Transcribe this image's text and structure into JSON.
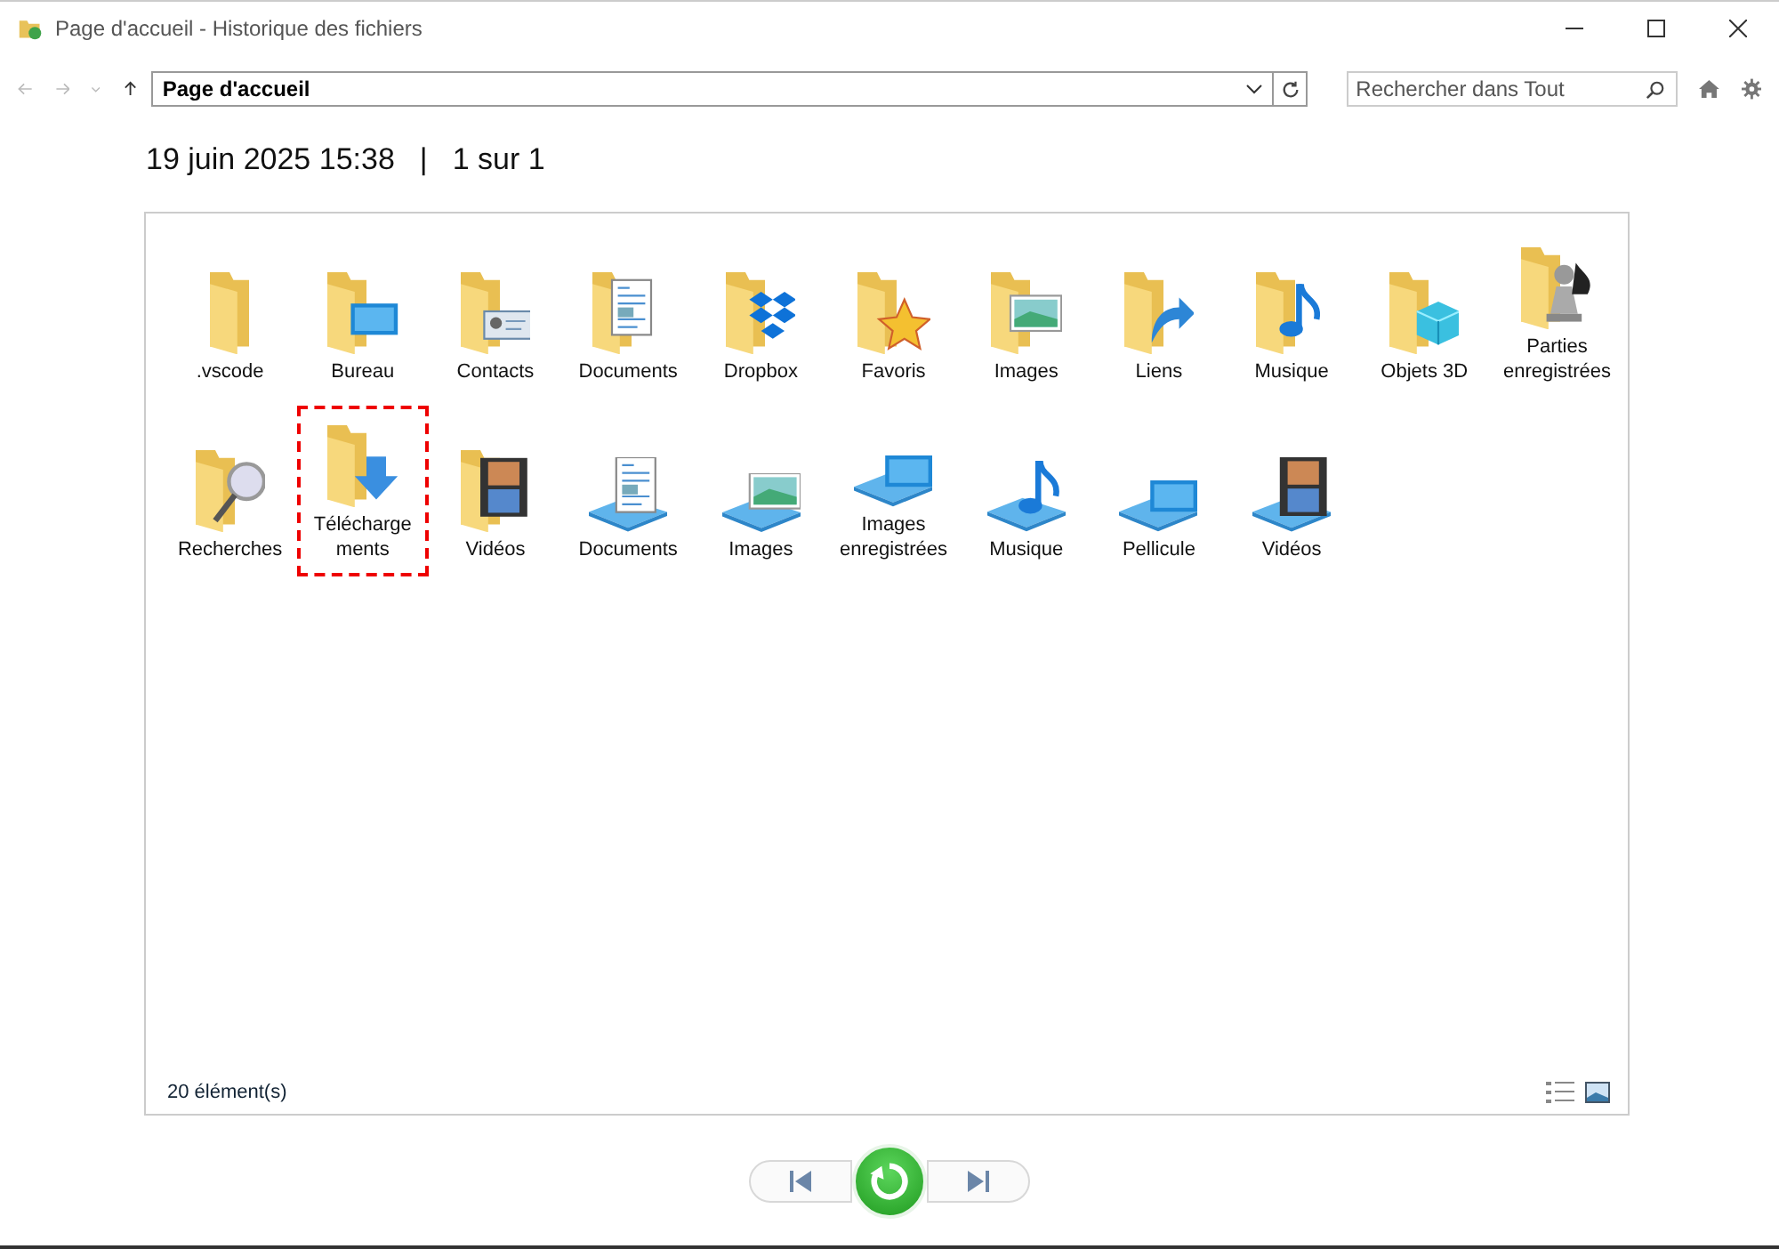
{
  "window": {
    "title": "Page d'accueil - Historique des fichiers"
  },
  "toolbar": {
    "address": "Page d'accueil",
    "search": {
      "placeholder": "Rechercher dans Tout"
    }
  },
  "header": {
    "date": "19 juin 2025 15:38",
    "separator": "|",
    "position": "1 sur 1"
  },
  "items": [
    {
      "label": ".vscode",
      "kind": "folder",
      "highlighted": false
    },
    {
      "label": "Bureau",
      "kind": "folder",
      "highlighted": false
    },
    {
      "label": "Contacts",
      "kind": "folder",
      "highlighted": false
    },
    {
      "label": "Documents",
      "kind": "folder",
      "highlighted": false
    },
    {
      "label": "Dropbox",
      "kind": "folder",
      "highlighted": false
    },
    {
      "label": "Favoris",
      "kind": "folder",
      "highlighted": false
    },
    {
      "label": "Images",
      "kind": "folder",
      "highlighted": false
    },
    {
      "label": "Liens",
      "kind": "folder",
      "highlighted": false
    },
    {
      "label": "Musique",
      "kind": "folder",
      "highlighted": false
    },
    {
      "label": "Objets 3D",
      "kind": "folder",
      "highlighted": false
    },
    {
      "label": "Parties enregistrées",
      "kind": "folder",
      "highlighted": false
    },
    {
      "label": "Recherches",
      "kind": "folder",
      "highlighted": false
    },
    {
      "label": "Télécharge ments",
      "kind": "folder",
      "highlighted": true
    },
    {
      "label": "Vidéos",
      "kind": "folder",
      "highlighted": false
    },
    {
      "label": "Documents",
      "kind": "library",
      "highlighted": false
    },
    {
      "label": "Images",
      "kind": "library",
      "highlighted": false
    },
    {
      "label": "Images enregistrées",
      "kind": "library",
      "highlighted": false
    },
    {
      "label": "Musique",
      "kind": "library",
      "highlighted": false
    },
    {
      "label": "Pellicule",
      "kind": "library",
      "highlighted": false
    },
    {
      "label": "Vidéos",
      "kind": "library",
      "highlighted": false
    }
  ],
  "status_bar": {
    "count": "20 élément(s)"
  }
}
